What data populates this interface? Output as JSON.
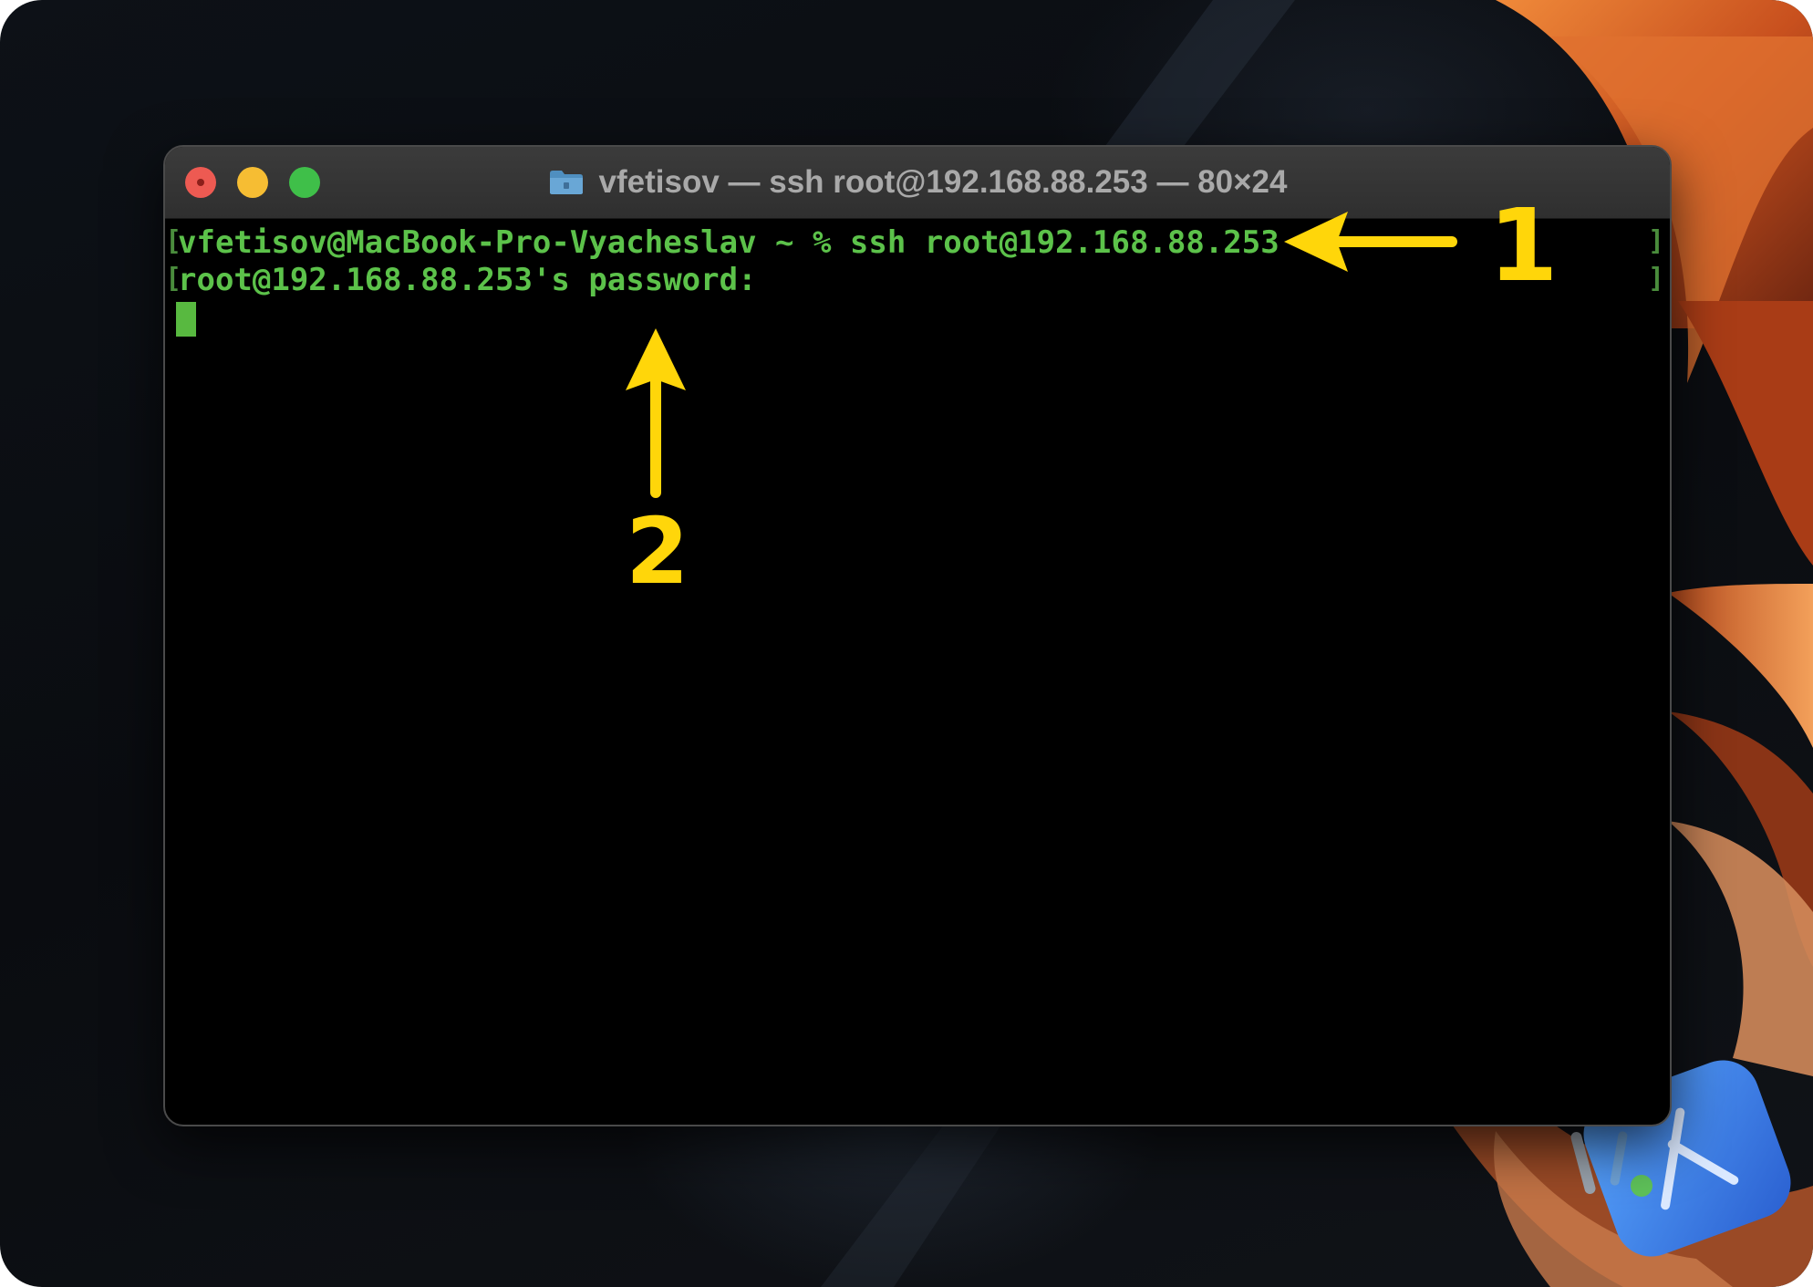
{
  "window": {
    "title": "vfetisov — ssh root@192.168.88.253 — 80×24",
    "folder_icon": "folder-icon",
    "buttons": [
      "close",
      "minimize",
      "zoom"
    ]
  },
  "terminal": {
    "lines": [
      "vfetisov@MacBook-Pro-Vyacheslav ~ % ssh root@192.168.88.253",
      "root@192.168.88.253's password:"
    ],
    "text_color": "#5cc24a",
    "background": "#000000"
  },
  "annotations": [
    {
      "label": "1",
      "pointer": "left-arrow",
      "color": "#ffd60a"
    },
    {
      "label": "2",
      "pointer": "up-arrow",
      "color": "#ffd60a"
    }
  ]
}
